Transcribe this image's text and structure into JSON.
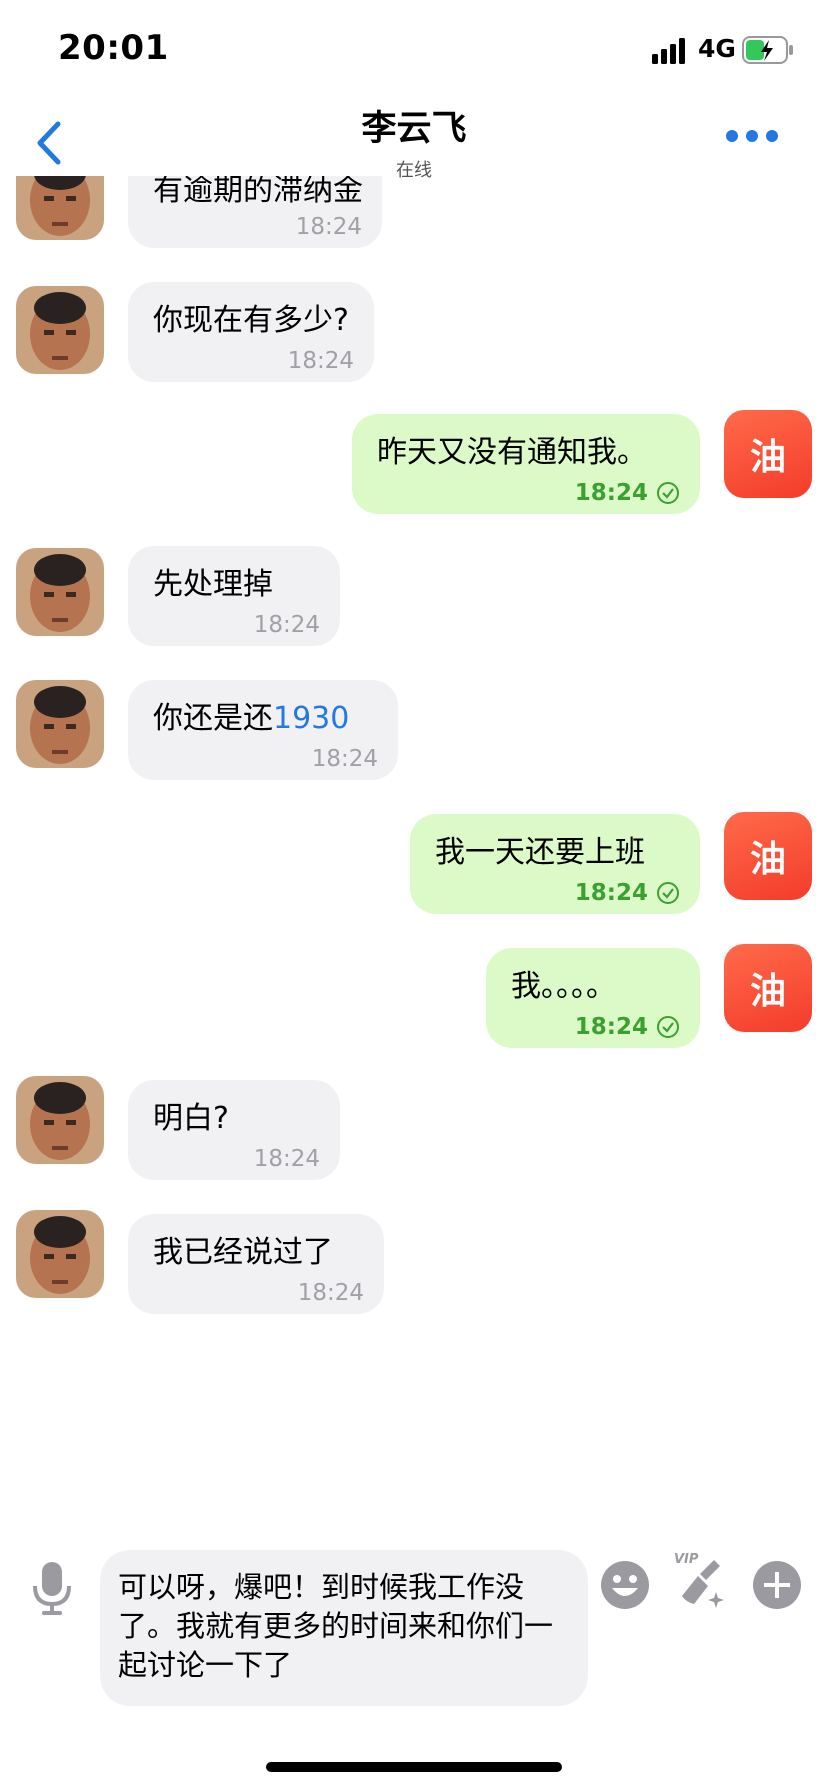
{
  "status_bar": {
    "time": "20:01",
    "network": "4G"
  },
  "header": {
    "title": "李云飞",
    "subtitle": "在线"
  },
  "messages": [
    {
      "side": "in",
      "text": "有逾期的滞纳金",
      "time": "18:24"
    },
    {
      "side": "in",
      "text": "你现在有多少?",
      "time": "18:24"
    },
    {
      "side": "out",
      "text": "昨天又没有通知我。",
      "time": "18:24"
    },
    {
      "side": "in",
      "text": "先处理掉",
      "time": "18:24"
    },
    {
      "side": "in",
      "text": "你还是还",
      "number": "1930",
      "time": "18:24"
    },
    {
      "side": "out",
      "text": "我一天还要上班",
      "time": "18:24"
    },
    {
      "side": "out",
      "text": "我。。。。",
      "time": "18:24"
    },
    {
      "side": "in",
      "text": "明白?",
      "time": "18:24"
    },
    {
      "side": "in",
      "text": "我已经说过了",
      "time": "18:24"
    }
  ],
  "self_avatar_label": "油",
  "input": {
    "value": "可以呀，爆吧！到时候我工作没了。我就有更多的时间来和你们一起讨论一下了",
    "vip_label": "VIP"
  },
  "colors": {
    "accent": "#2479e0",
    "incoming_bubble": "#f1f1f4",
    "outgoing_bubble": "#dcfac8",
    "outgoing_time": "#3aa02e",
    "self_avatar": "#f33c2a"
  },
  "icons": [
    "signal-icon",
    "battery-icon",
    "back-icon",
    "more-icon",
    "check-icon",
    "mic-icon",
    "emoji-icon",
    "vip-brush-icon",
    "plus-icon"
  ]
}
